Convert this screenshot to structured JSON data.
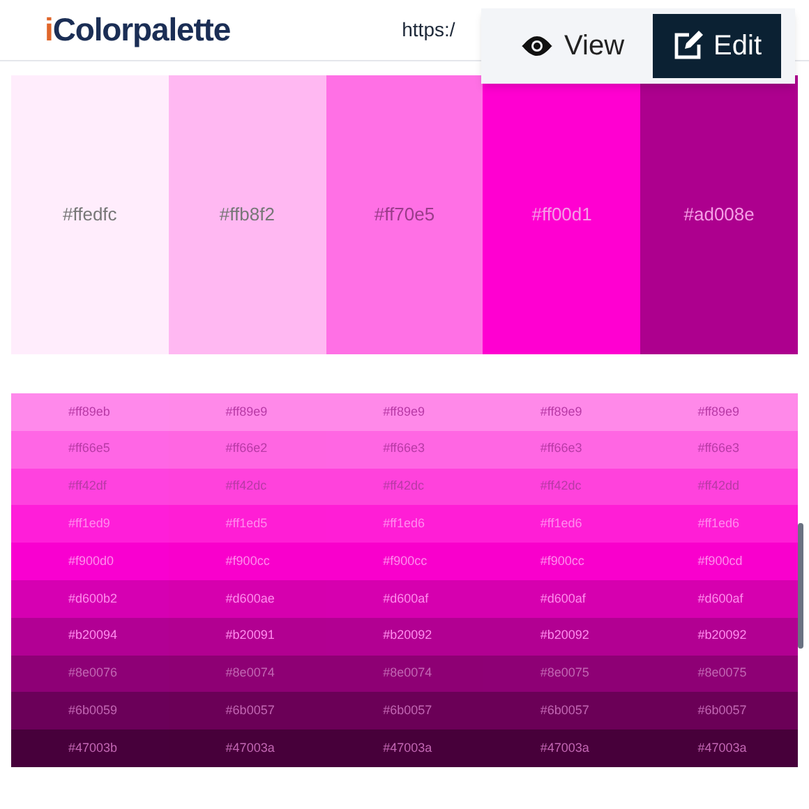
{
  "header": {
    "logo_accent": "i",
    "logo_rest": "Colorpalette",
    "url": "https:/"
  },
  "view_menu": [
    {
      "label": "View",
      "kind": "view",
      "selected": false
    },
    {
      "label": "Edit",
      "kind": "edit",
      "selected": true
    }
  ],
  "swatches": [
    {
      "hex": "#ffedfc",
      "color": "#ffedfc"
    },
    {
      "hex": "#ffb8f2",
      "color": "#ffb8f2"
    },
    {
      "hex": "#ff70e5",
      "color": "#ff70e5"
    },
    {
      "hex": "#ff00d1",
      "color": "#ff00d1"
    },
    {
      "hex": "#ad008e",
      "color": "#ad008e"
    }
  ],
  "shades": [
    {
      "cells": [
        {
          "hex": "#ff89eb",
          "color": "#ff89eb"
        },
        {
          "hex": "#ff89e9",
          "color": "#ff89e9"
        },
        {
          "hex": "#ff89e9",
          "color": "#ff89e9"
        },
        {
          "hex": "#ff89e9",
          "color": "#ff89e9"
        },
        {
          "hex": "#ff89e9",
          "color": "#ff89e9"
        }
      ]
    },
    {
      "cells": [
        {
          "hex": "#ff66e5",
          "color": "#ff66e5"
        },
        {
          "hex": "#ff66e2",
          "color": "#ff66e2"
        },
        {
          "hex": "#ff66e3",
          "color": "#ff66e3"
        },
        {
          "hex": "#ff66e3",
          "color": "#ff66e3"
        },
        {
          "hex": "#ff66e3",
          "color": "#ff66e3"
        }
      ]
    },
    {
      "cells": [
        {
          "hex": "#ff42df",
          "color": "#ff42df"
        },
        {
          "hex": "#ff42dc",
          "color": "#ff42dc"
        },
        {
          "hex": "#ff42dc",
          "color": "#ff42dc"
        },
        {
          "hex": "#ff42dc",
          "color": "#ff42dc"
        },
        {
          "hex": "#ff42dd",
          "color": "#ff42dd"
        }
      ]
    },
    {
      "cells": [
        {
          "hex": "#ff1ed9",
          "color": "#ff1ed9"
        },
        {
          "hex": "#ff1ed5",
          "color": "#ff1ed5"
        },
        {
          "hex": "#ff1ed6",
          "color": "#ff1ed6"
        },
        {
          "hex": "#ff1ed6",
          "color": "#ff1ed6"
        },
        {
          "hex": "#ff1ed6",
          "color": "#ff1ed6"
        }
      ]
    },
    {
      "cells": [
        {
          "hex": "#f900d0",
          "color": "#f900d0"
        },
        {
          "hex": "#f900cc",
          "color": "#f900cc"
        },
        {
          "hex": "#f900cc",
          "color": "#f900cc"
        },
        {
          "hex": "#f900cc",
          "color": "#f900cc"
        },
        {
          "hex": "#f900cd",
          "color": "#f900cd"
        }
      ]
    },
    {
      "cells": [
        {
          "hex": "#d600b2",
          "color": "#d600b2"
        },
        {
          "hex": "#d600ae",
          "color": "#d600ae"
        },
        {
          "hex": "#d600af",
          "color": "#d600af"
        },
        {
          "hex": "#d600af",
          "color": "#d600af"
        },
        {
          "hex": "#d600af",
          "color": "#d600af"
        }
      ]
    },
    {
      "cells": [
        {
          "hex": "#b20094",
          "color": "#b20094"
        },
        {
          "hex": "#b20091",
          "color": "#b20091"
        },
        {
          "hex": "#b20092",
          "color": "#b20092"
        },
        {
          "hex": "#b20092",
          "color": "#b20092"
        },
        {
          "hex": "#b20092",
          "color": "#b20092"
        }
      ]
    },
    {
      "cells": [
        {
          "hex": "#8e0076",
          "color": "#8e0076"
        },
        {
          "hex": "#8e0074",
          "color": "#8e0074"
        },
        {
          "hex": "#8e0074",
          "color": "#8e0074"
        },
        {
          "hex": "#8e0075",
          "color": "#8e0075"
        },
        {
          "hex": "#8e0075",
          "color": "#8e0075"
        }
      ]
    },
    {
      "cells": [
        {
          "hex": "#6b0059",
          "color": "#6b0059"
        },
        {
          "hex": "#6b0057",
          "color": "#6b0057"
        },
        {
          "hex": "#6b0057",
          "color": "#6b0057"
        },
        {
          "hex": "#6b0057",
          "color": "#6b0057"
        },
        {
          "hex": "#6b0057",
          "color": "#6b0057"
        }
      ]
    },
    {
      "cells": [
        {
          "hex": "#47003b",
          "color": "#47003b"
        },
        {
          "hex": "#47003a",
          "color": "#47003a"
        },
        {
          "hex": "#47003a",
          "color": "#47003a"
        },
        {
          "hex": "#47003a",
          "color": "#47003a"
        },
        {
          "hex": "#47003a",
          "color": "#47003a"
        }
      ]
    }
  ]
}
